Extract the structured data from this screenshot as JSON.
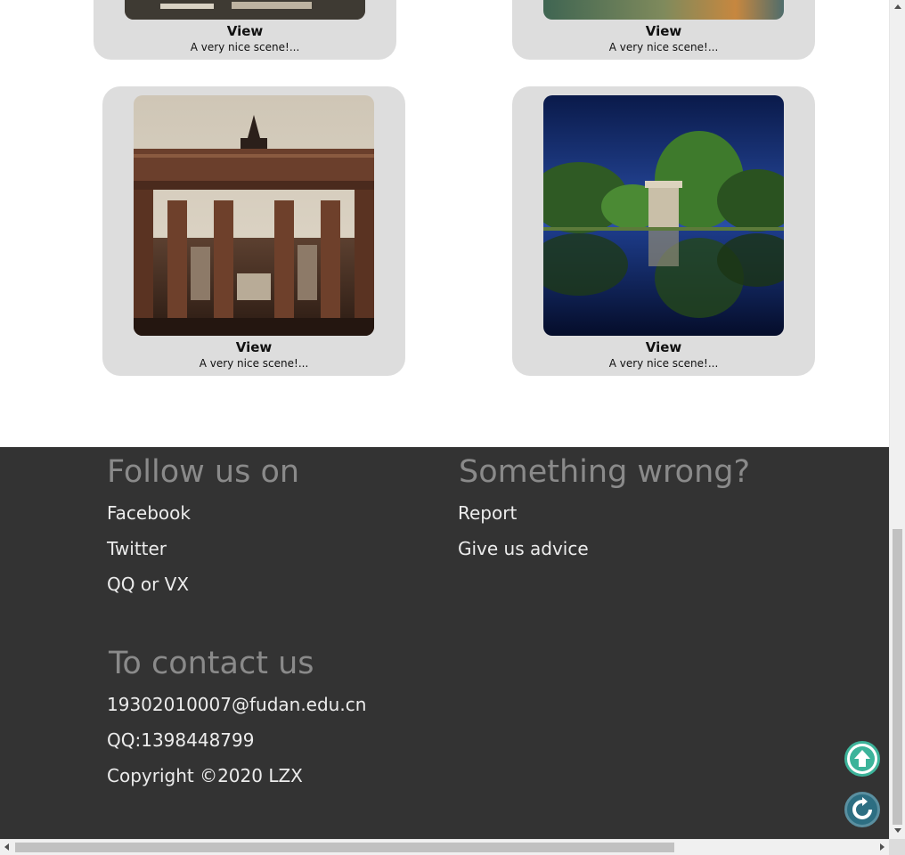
{
  "gallery": {
    "cards": [
      {
        "view_label": "View",
        "description": "A very nice scene!..."
      },
      {
        "view_label": "View",
        "description": "A very nice scene!..."
      },
      {
        "view_label": "View",
        "description": "A very nice scene!..."
      },
      {
        "view_label": "View",
        "description": "A very nice scene!..."
      }
    ]
  },
  "footer": {
    "follow": {
      "heading": "Follow us on",
      "links": [
        "Facebook",
        "Twitter",
        "QQ or VX"
      ]
    },
    "wrong": {
      "heading": "Something wrong?",
      "links": [
        "Report",
        "Give us advice"
      ]
    },
    "contact": {
      "heading": "To contact us",
      "email": "19302010007@fudan.edu.cn",
      "qq": "QQ:1398448799",
      "copyright": "Copyright ©2020 LZX"
    }
  },
  "floating_buttons": {
    "top_icon": "arrow-up-icon",
    "refresh_icon": "refresh-icon",
    "top_color": "#3cb39a",
    "refresh_color": "#2d6e82"
  },
  "colors": {
    "card_bg": "#dddddd",
    "footer_bg": "#333333",
    "footer_heading": "#8a8a8a",
    "footer_link": "#ececec"
  }
}
